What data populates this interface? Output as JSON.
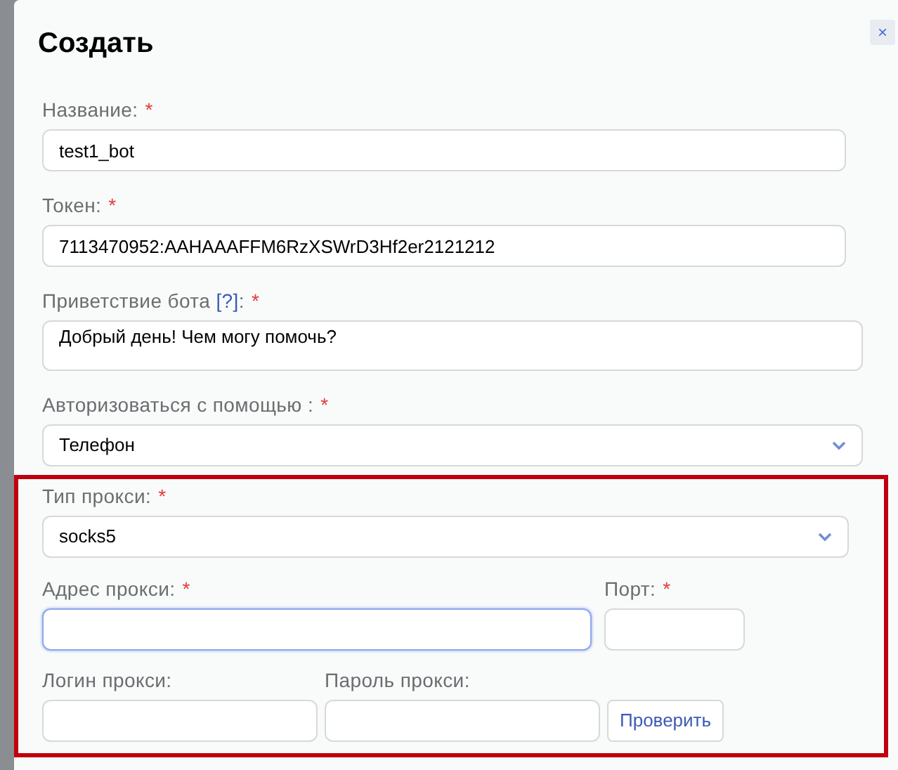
{
  "dialog": {
    "title": "Создать",
    "close": "×"
  },
  "fields": [
    {
      "kind": "text",
      "label": "Название:",
      "required_mark": "*",
      "value": "test1_bot"
    },
    {
      "kind": "text",
      "label": "Токен:",
      "required_mark": "*",
      "value": "7113470952:AAHAAAFFM6RzXSWrD3Hf2er2121212"
    },
    {
      "kind": "textarea",
      "label": "Приветствие бота",
      "help": "[?]",
      "suffix": ":",
      "required_mark": "*",
      "value": "Добрый день! Чем могу помочь?"
    },
    {
      "kind": "select",
      "label": "Авторизоваться с помощью :",
      "required_mark": "*",
      "value": "Телефон"
    }
  ],
  "proxy_section": {
    "highlighted": true,
    "type": {
      "label": "Тип прокси:",
      "required_mark": "*",
      "value": "socks5"
    },
    "address": {
      "label": "Адрес прокси:",
      "required_mark": "*",
      "focused": true
    },
    "port": {
      "label": "Порт:",
      "required_mark": "*"
    },
    "login": {
      "label": "Логин прокси:"
    },
    "password": {
      "label": "Пароль прокси:"
    },
    "check_button": "Проверить"
  }
}
